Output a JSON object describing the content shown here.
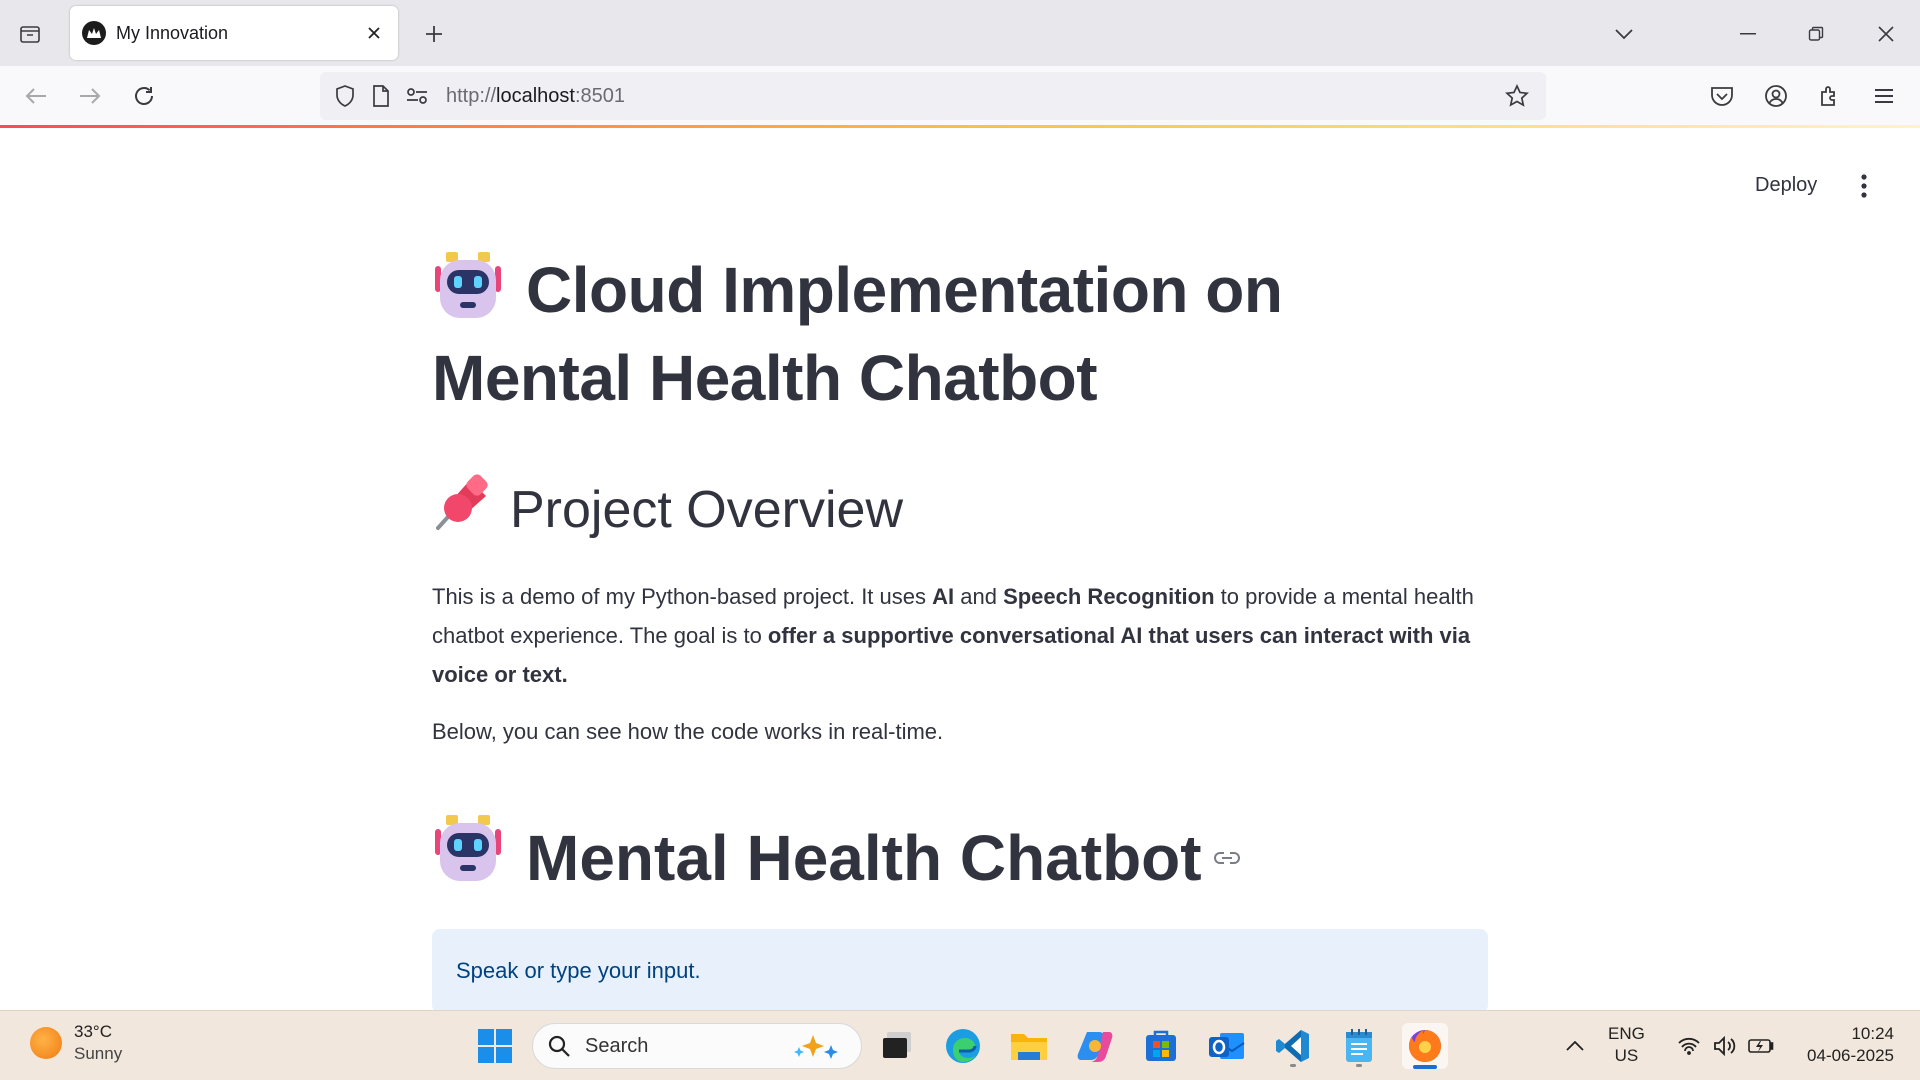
{
  "browser": {
    "tab_title": "My Innovation",
    "url_prefix": "http://",
    "url_host": "localhost",
    "url_port": ":8501"
  },
  "app": {
    "deploy_label": "Deploy",
    "title_line1": "Cloud Implementation on",
    "title_line2": "Mental Health Chatbot",
    "overview_heading": "Project Overview",
    "para1": {
      "t1": "This is a demo of my Python-based project. It uses ",
      "b1": "AI",
      "t2": " and ",
      "b2": "Speech Recognition",
      "t3": " to provide a mental health chatbot experience. The goal is to ",
      "b3": "offer a supportive conversational AI that users can interact with via voice or text."
    },
    "para2": "Below, you can see how the code works in real-time.",
    "chatbot_heading": "Mental Health Chatbot",
    "info_text": "Speak or type your input.",
    "accent_color": "#ff4b4b"
  },
  "taskbar": {
    "weather_temp": "33°C",
    "weather_cond": "Sunny",
    "search_placeholder": "Search",
    "lang_line1": "ENG",
    "lang_line2": "US",
    "time": "10:24",
    "date": "04-06-2025"
  }
}
